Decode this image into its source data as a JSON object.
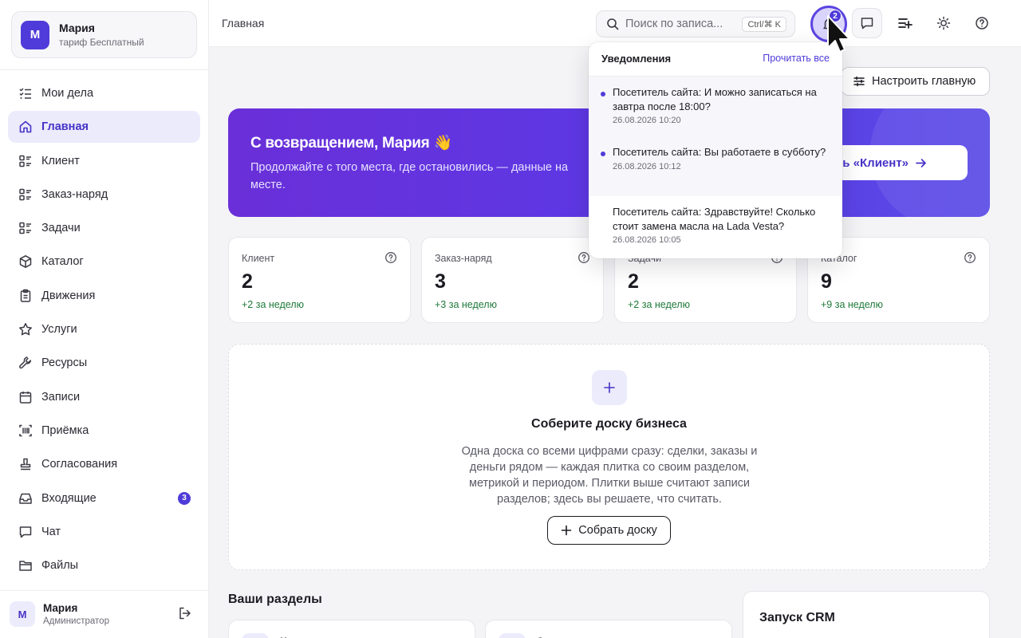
{
  "workspace": {
    "initial": "М",
    "name": "Мария",
    "plan": "тариф Бесплатный"
  },
  "nav": [
    {
      "label": "Мои дела",
      "icon": "checklist-icon"
    },
    {
      "label": "Главная",
      "icon": "home-icon",
      "active": true
    },
    {
      "label": "Клиент",
      "icon": "list-icon"
    },
    {
      "label": "Заказ-наряд",
      "icon": "list-icon"
    },
    {
      "label": "Задачи",
      "icon": "list-icon"
    },
    {
      "label": "Каталог",
      "icon": "box-icon"
    },
    {
      "label": "Движения",
      "icon": "clipboard-icon"
    },
    {
      "label": "Услуги",
      "icon": "star-icon"
    },
    {
      "label": "Ресурсы",
      "icon": "wrench-icon"
    },
    {
      "label": "Записи",
      "icon": "calendar-icon"
    },
    {
      "label": "Приёмка",
      "icon": "barcode-icon"
    },
    {
      "label": "Согласования",
      "icon": "stamp-icon"
    },
    {
      "label": "Входящие",
      "icon": "inbox-icon",
      "badge": "3"
    },
    {
      "label": "Чат",
      "icon": "chat-icon"
    },
    {
      "label": "Файлы",
      "icon": "folder-icon"
    }
  ],
  "user": {
    "initial": "М",
    "name": "Мария",
    "role": "Администратор"
  },
  "topbar": {
    "breadcrumb": "Главная",
    "search_placeholder": "Поиск по записа...",
    "search_shortcut": "Ctrl/⌘ K",
    "notif_count": "2"
  },
  "main": {
    "config_button": "Настроить главную",
    "hero": {
      "title": "С возвращением, Мария 👋",
      "subtitle": "Продолжайте с того места, где остановились — данные на месте.",
      "button": "рыть «Клиент»"
    },
    "kpis": [
      {
        "label": "Клиент",
        "value": "2",
        "delta": "+2 за неделю"
      },
      {
        "label": "Заказ-наряд",
        "value": "3",
        "delta": "+3 за неделю"
      },
      {
        "label": "Задачи",
        "value": "2",
        "delta": "+2 за неделю"
      },
      {
        "label": "Каталог",
        "value": "9",
        "delta": "+9 за неделю"
      }
    ],
    "empty": {
      "title": "Соберите доску бизнеса",
      "description": "Одна доска со всеми цифрами сразу: сделки, заказы и деньги рядом — каждая плитка со своим разделом, метрикой и периодом. Плитки выше считают записи разделов; здесь вы решаете, что считать.",
      "button": "Собрать доску"
    },
    "sections_title": "Ваши разделы",
    "section_cards": [
      "К",
      "З"
    ],
    "crm_title": "Запуск CRM"
  },
  "notifications": {
    "title": "Уведомления",
    "read_all": "Прочитать все",
    "items": [
      {
        "text": "Посетитель сайта: И можно записаться на завтра после 18:00?",
        "time": "26.08.2026 10:20",
        "unread": true
      },
      {
        "text": "Посетитель сайта: Вы работаете в субботу?",
        "time": "26.08.2026 10:12",
        "unread": true
      },
      {
        "text": "Посетитель сайта: Здравствуйте! Сколько стоит замена масла на Lada Vesta?",
        "time": "26.08.2026 10:05",
        "unread": false
      }
    ]
  },
  "colors": {
    "accent": "#4f3bd9",
    "accent_soft": "#ecebfb",
    "positive": "#1f7a3a"
  }
}
